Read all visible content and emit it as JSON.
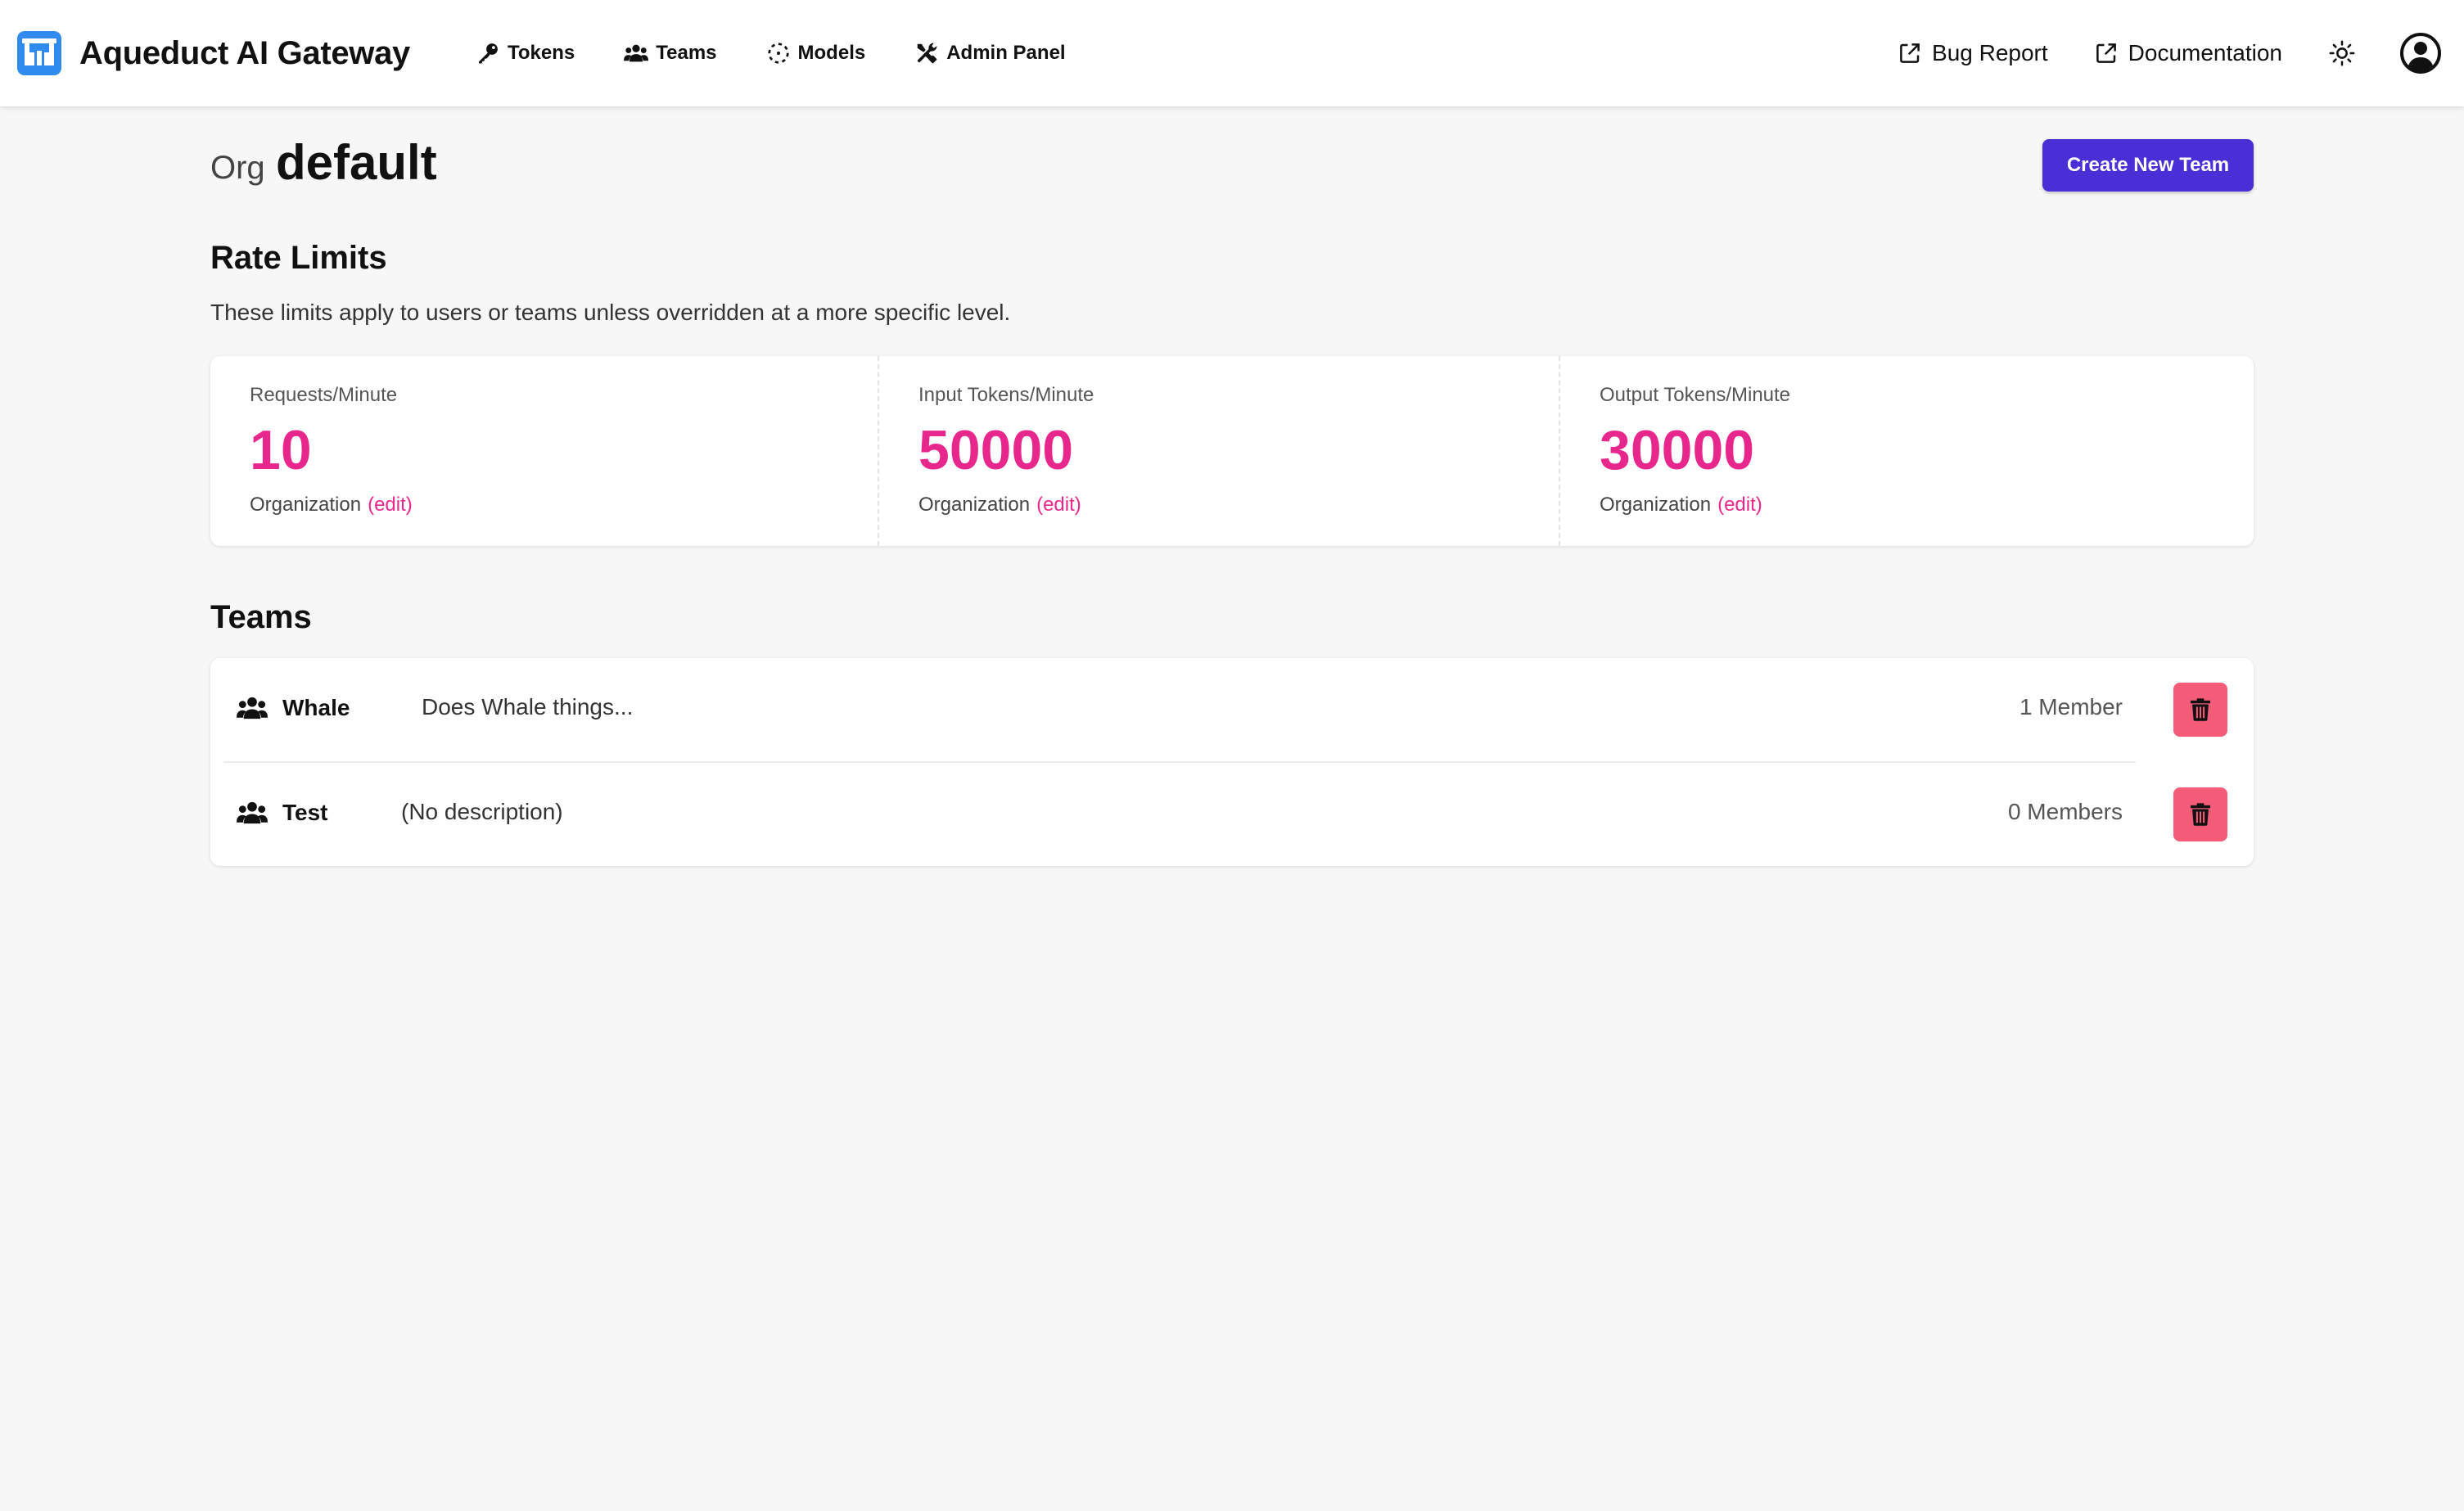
{
  "app": {
    "title": "Aqueduct AI Gateway",
    "logo_icon": "aqueduct-logo-icon",
    "accent_color": "#2f8bf0"
  },
  "nav": {
    "items": [
      {
        "label": "Tokens",
        "icon": "key-icon"
      },
      {
        "label": "Teams",
        "icon": "users-icon"
      },
      {
        "label": "Models",
        "icon": "dashed-circle-icon"
      },
      {
        "label": "Admin Panel",
        "icon": "tools-icon"
      }
    ]
  },
  "header_right": {
    "bug_report": "Bug Report",
    "documentation": "Documentation",
    "theme_icon": "sun-icon",
    "avatar_icon": "user-circle-icon"
  },
  "page": {
    "org_prefix": "Org",
    "org_name": "default",
    "create_button": "Create New Team",
    "create_button_color": "#4a2ed6"
  },
  "rate_limits": {
    "title": "Rate Limits",
    "description": "These limits apply to users or teams unless overridden at a more specific level.",
    "value_color": "#e8278d",
    "items": [
      {
        "label": "Requests/Minute",
        "value": "10",
        "scope": "Organization",
        "edit": "(edit)"
      },
      {
        "label": "Input Tokens/Minute",
        "value": "50000",
        "scope": "Organization",
        "edit": "(edit)"
      },
      {
        "label": "Output Tokens/Minute",
        "value": "30000",
        "scope": "Organization",
        "edit": "(edit)"
      }
    ]
  },
  "teams": {
    "title": "Teams",
    "delete_color": "#f45b79",
    "rows": [
      {
        "name": "Whale",
        "description": "Does Whale things...",
        "members": "1 Member"
      },
      {
        "name": "Test",
        "description": "(No description)",
        "members": "0 Members"
      }
    ]
  }
}
